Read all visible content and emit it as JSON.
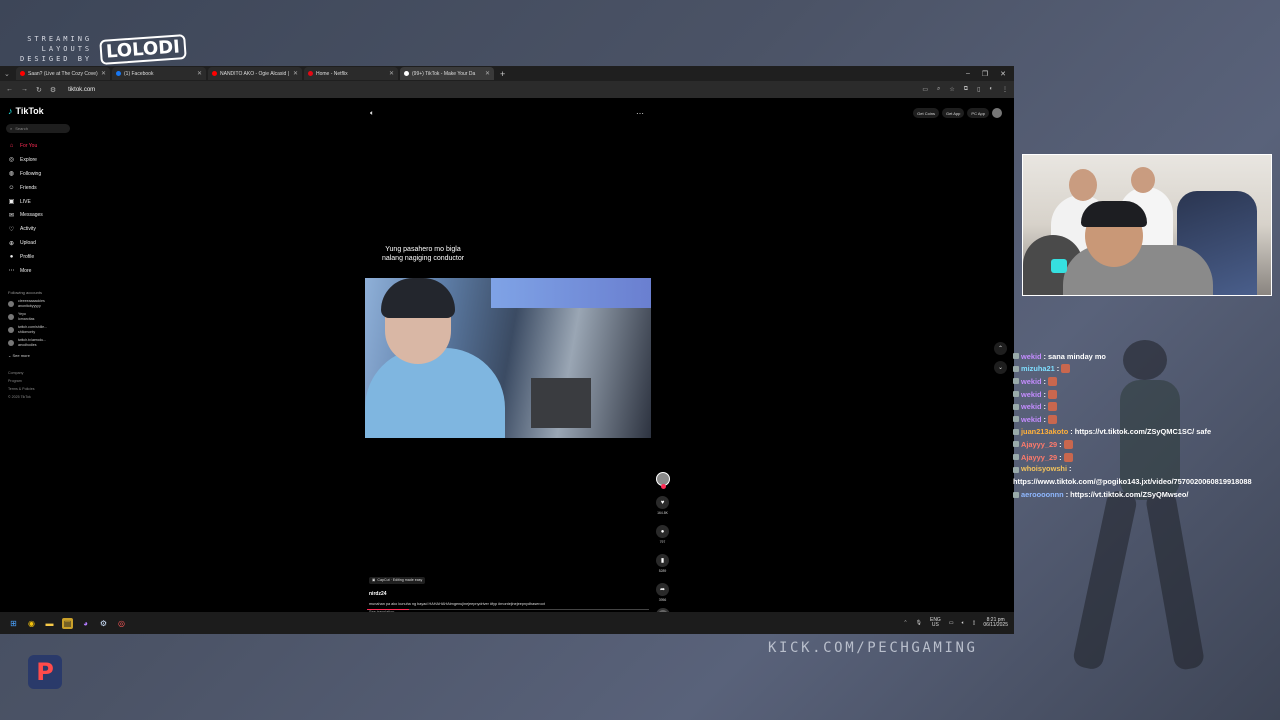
{
  "overlay": {
    "brand_line1": "STREAMING",
    "brand_line2": "LAYOUTS",
    "brand_line3": "DESIGED BY",
    "brand_logo": "LOLODI",
    "kick_url": "KICK.COM/PECHGAMING",
    "corner_logo": "P"
  },
  "browser": {
    "tabs": [
      {
        "title": "Saan? (Live at The Cozy Cove)",
        "color": "#ff0000",
        "active": false
      },
      {
        "title": "(1) Facebook",
        "color": "#1877f2",
        "active": false
      },
      {
        "title": "NANDITO AKO - Ogie Alcasid |",
        "color": "#ff0000",
        "active": false
      },
      {
        "title": "Home - Netflix",
        "color": "#e50914",
        "active": false
      },
      {
        "title": "(99+) TikTok - Make Your Da",
        "color": "#ffffff",
        "active": true
      }
    ],
    "url": "tiktok.com"
  },
  "tiktok": {
    "logo": "TikTok",
    "search_placeholder": "Search",
    "nav": [
      {
        "label": "For You",
        "icon": "home-icon",
        "glyph": "⌂",
        "active": true
      },
      {
        "label": "Explore",
        "icon": "compass-icon",
        "glyph": "◎",
        "active": false
      },
      {
        "label": "Following",
        "icon": "following-icon",
        "glyph": "◍",
        "active": false
      },
      {
        "label": "Friends",
        "icon": "friends-icon",
        "glyph": "☺",
        "active": false
      },
      {
        "label": "LIVE",
        "icon": "live-icon",
        "glyph": "▣",
        "active": false
      },
      {
        "label": "Messages",
        "icon": "messages-icon",
        "glyph": "✉",
        "active": false
      },
      {
        "label": "Activity",
        "icon": "activity-icon",
        "glyph": "♡",
        "active": false
      },
      {
        "label": "Upload",
        "icon": "upload-icon",
        "glyph": "⊕",
        "active": false
      },
      {
        "label": "Profile",
        "icon": "profile-icon",
        "glyph": "●",
        "active": false
      },
      {
        "label": "More",
        "icon": "more-icon",
        "glyph": "⋯",
        "active": false
      }
    ],
    "following_title": "Following accounts",
    "accounts": [
      {
        "line1": "cleeeeaaaackies",
        "line2": "anonitobyyyyy"
      },
      {
        "line1": "Yeyo",
        "line2": "lomarcitas"
      },
      {
        "line1": "twitch.com/shille...",
        "line2": "shilomonty"
      },
      {
        "line1": "twitch.tv/aerodu...",
        "line2": "aeodhodies"
      }
    ],
    "see_more": "See more",
    "footer": [
      "Company",
      "Program",
      "Terms & Policies",
      "© 2025 TikTok"
    ],
    "top_actions": [
      "Get Coins",
      "Get App",
      "PC App"
    ],
    "caption": "Yung pasahero mo bigla nalang nagiging conductor",
    "counts": {
      "likes": "164.8K",
      "comments": "797",
      "saves": "5289",
      "shares": "3956"
    },
    "capcut": "CapCut · Editing made easy",
    "author": "nirdz24",
    "description": "munahan pa ako kunuha ng bayad HAHAHAHAtmgenujinejeepnydriver #fyp #montejinejeepnydhaseroot",
    "see_translation": "See translation",
    "progress_fraction": 0.15
  },
  "taskbar": {
    "lang1": "ENG",
    "lang2": "US",
    "time": "8:21 pm",
    "date": "06/11/2025"
  },
  "chat": [
    {
      "user": "wekid",
      "color": "#c48cff",
      "text": "sana minday mo",
      "emote": false
    },
    {
      "user": "mizuha21",
      "color": "#7fdfff",
      "text": "",
      "emote": true
    },
    {
      "user": "wekid",
      "color": "#c48cff",
      "text": "",
      "emote": true
    },
    {
      "user": "wekid",
      "color": "#c48cff",
      "text": "",
      "emote": true
    },
    {
      "user": "wekid",
      "color": "#c48cff",
      "text": "",
      "emote": true
    },
    {
      "user": "wekid",
      "color": "#c48cff",
      "text": "",
      "emote": true
    },
    {
      "user": "juan213akoto",
      "color": "#ffb03a",
      "text": "https://vt.tiktok.com/ZSyQMC1SC/ safe",
      "emote": false
    },
    {
      "user": "Ajayyy_29",
      "color": "#ff7a6b",
      "text": "",
      "emote": true
    },
    {
      "user": "Ajayyy_29",
      "color": "#ff7a6b",
      "text": "",
      "emote": true
    },
    {
      "user": "whoisyowshi",
      "color": "#f3c35b",
      "text": "https://www.tiktok.com/@pogiko143.jxt/video/7570020060819918088",
      "emote": false
    },
    {
      "user": "aeroooonnn",
      "color": "#8fb8ff",
      "text": "https://vt.tiktok.com/ZSyQMwseo/",
      "emote": false
    }
  ]
}
